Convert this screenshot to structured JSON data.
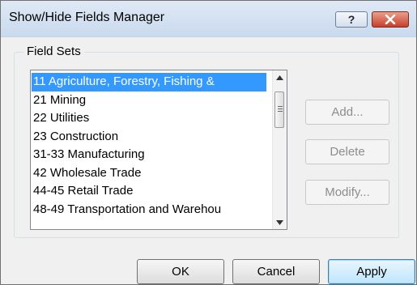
{
  "window": {
    "title": "Show/Hide Fields Manager",
    "help_label": "?"
  },
  "field_sets": {
    "label": "Field Sets",
    "items": [
      "11 Agriculture, Forestry, Fishing &",
      "21 Mining",
      "22 Utilities",
      "23 Construction",
      "31-33 Manufacturing",
      "42 Wholesale Trade",
      "44-45 Retail Trade",
      "48-49 Transportation and Warehou"
    ],
    "selected_index": 0
  },
  "side_buttons": {
    "add": "Add...",
    "delete": "Delete",
    "modify": "Modify..."
  },
  "buttons": {
    "ok": "OK",
    "cancel": "Cancel",
    "apply": "Apply"
  },
  "colors": {
    "selection": "#3399ff",
    "disabled_text": "#8d8d8d"
  }
}
